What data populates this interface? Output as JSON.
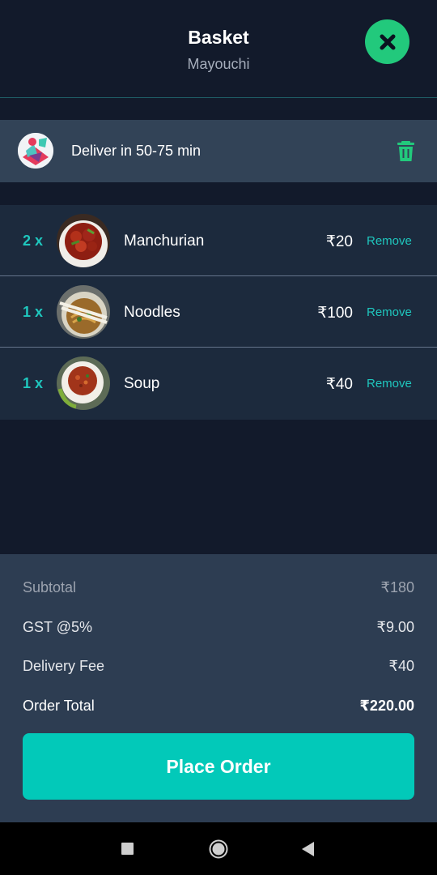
{
  "header": {
    "title": "Basket",
    "subtitle": "Mayouchi",
    "close_icon": "close-icon",
    "accent": "#22c97c"
  },
  "delivery": {
    "text": "Deliver in 50-75 min",
    "trash_icon": "trash-icon"
  },
  "items": [
    {
      "qty": "2 x",
      "name": "Manchurian",
      "price": "₹20",
      "remove": "Remove",
      "image": "manchurian-image"
    },
    {
      "qty": "1 x",
      "name": "Noodles",
      "price": "₹100",
      "remove": "Remove",
      "image": "noodles-image"
    },
    {
      "qty": "1 x",
      "name": "Soup",
      "price": "₹40",
      "remove": "Remove",
      "image": "soup-image"
    }
  ],
  "summary": {
    "subtotal_label": "Subtotal",
    "subtotal_value": "₹180",
    "gst_label": "GST @5%",
    "gst_value": "₹9.00",
    "delivery_fee_label": "Delivery Fee",
    "delivery_fee_value": "₹40",
    "total_label": "Order Total",
    "total_value": "₹220.00"
  },
  "place_order_label": "Place Order",
  "colors": {
    "background": "#121a2b",
    "accent_teal": "#02c9b9",
    "qty_teal": "#1fc7be"
  }
}
